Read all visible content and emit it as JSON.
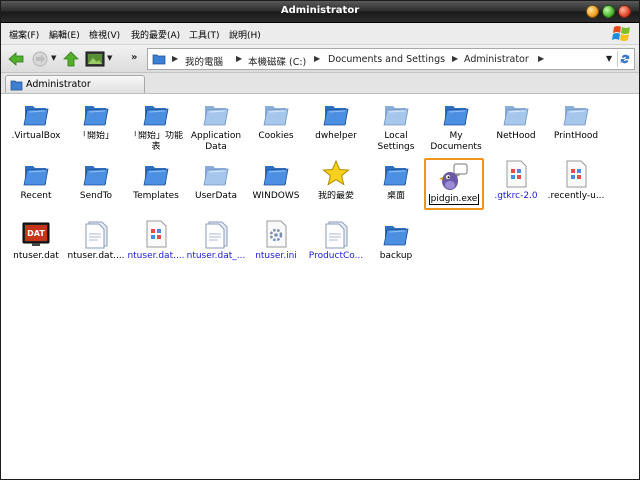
{
  "window": {
    "title": "Administrator"
  },
  "menu": [
    {
      "label": "檔案(F)"
    },
    {
      "label": "編輯(E)"
    },
    {
      "label": "檢視(V)"
    },
    {
      "label": "我的最愛(A)"
    },
    {
      "label": "工具(T)"
    },
    {
      "label": "說明(H)"
    }
  ],
  "toolbar": {
    "overflow": "»"
  },
  "address": {
    "crumbs": [
      "我的電腦",
      "本機磁碟 (C:)",
      "Documents and Settings",
      "Administrator"
    ]
  },
  "tab": {
    "label": "Administrator"
  },
  "items": [
    {
      "label": ".VirtualBox",
      "icon": "folder-icon"
    },
    {
      "label": "「開始」",
      "icon": "folder-icon"
    },
    {
      "label": "「開始」功能表",
      "icon": "folder-icon"
    },
    {
      "label": "Application Data",
      "icon": "folder-faded-icon"
    },
    {
      "label": "Cookies",
      "icon": "folder-faded-icon"
    },
    {
      "label": "dwhelper",
      "icon": "folder-icon"
    },
    {
      "label": "Local Settings",
      "icon": "folder-faded-icon"
    },
    {
      "label": "My Documents",
      "icon": "folder-icon"
    },
    {
      "label": "NetHood",
      "icon": "folder-faded-icon"
    },
    {
      "label": "PrintHood",
      "icon": "folder-faded-icon"
    },
    {
      "label": "Recent",
      "icon": "folder-icon"
    },
    {
      "label": "SendTo",
      "icon": "folder-icon"
    },
    {
      "label": "Templates",
      "icon": "folder-icon"
    },
    {
      "label": "UserData",
      "icon": "folder-faded-icon"
    },
    {
      "label": "WINDOWS",
      "icon": "folder-icon"
    },
    {
      "label": "我的最愛",
      "icon": "star-folder-icon"
    },
    {
      "label": "桌面",
      "icon": "folder-icon"
    },
    {
      "label": "pidgin.exe",
      "icon": "pidgin-icon",
      "selected": true
    },
    {
      "label": ".gtkrc-2.0",
      "icon": "config-file-icon",
      "blue": true
    },
    {
      "label": ".recently-u...",
      "icon": "config-file-icon"
    },
    {
      "label": "ntuser.dat",
      "icon": "dat-file-icon"
    },
    {
      "label": "ntuser.dat....",
      "icon": "generic-file-icon"
    },
    {
      "label": "ntuser.dat....",
      "icon": "config-file-icon",
      "blue": true
    },
    {
      "label": "ntuser.dat_...",
      "icon": "generic-file-icon",
      "blue": true
    },
    {
      "label": "ntuser.ini",
      "icon": "ini-file-icon",
      "blue": true
    },
    {
      "label": "ProductCo...",
      "icon": "generic-file-icon",
      "blue": true
    },
    {
      "label": "backup",
      "icon": "folder-icon"
    }
  ]
}
